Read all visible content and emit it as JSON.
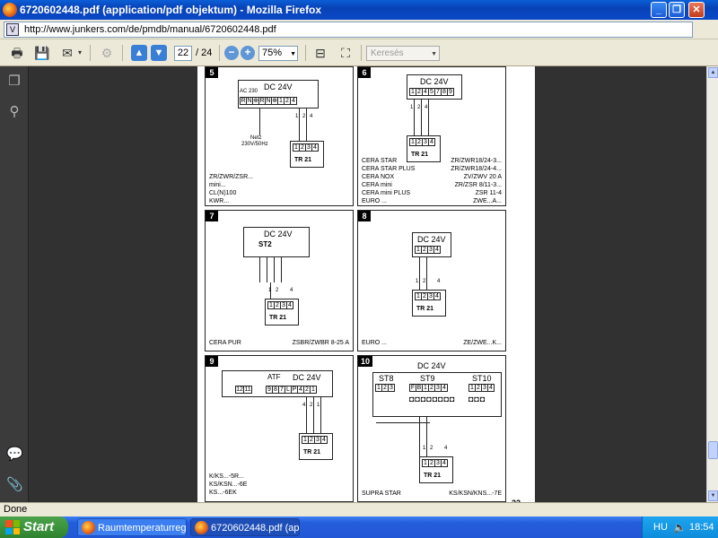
{
  "window": {
    "title": "6720602448.pdf (application/pdf objektum) - Mozilla Firefox",
    "minimize_label": "_",
    "maximize_label": "❐",
    "close_label": "✕"
  },
  "address": {
    "url": "http://www.junkers.com/de/pmdb/manual/6720602448.pdf",
    "site_icon": "V"
  },
  "pdf_toolbar": {
    "current_page": "22",
    "total_pages": "/ 24",
    "zoom": "75%",
    "search_placeholder": "Keresés"
  },
  "page": {
    "footer_page_number": "22",
    "panels": [
      {
        "number": "5",
        "header": "DC 24V",
        "ac_label": "AC 230",
        "top_cells": [
          "R",
          "N",
          "⊕",
          "R",
          "N",
          "⊕",
          "1",
          "2",
          "4"
        ],
        "netz_label": "Netz",
        "netz_voltage": "230V/50Hz",
        "wire_numbers": [
          "1",
          "2",
          "4"
        ],
        "tr_cells": [
          "1",
          "2",
          "3",
          "4"
        ],
        "tr_label": "TR 21",
        "captions": [
          "ZR/ZWR/ZSR...",
          "mini...",
          "CL(N)100",
          "KWR..."
        ]
      },
      {
        "number": "6",
        "header": "DC 24V",
        "top_cells": [
          "1",
          "2",
          "4",
          "5",
          "7",
          "8",
          "9"
        ],
        "wire_numbers": [
          "1",
          "2",
          "4"
        ],
        "tr_cells": [
          "1",
          "2",
          "3",
          "4"
        ],
        "tr_label": "TR 21",
        "captions_left": [
          "CERA STAR",
          "CERA STAR PLUS",
          "CERA NOX",
          "CERA mini",
          "CERA mini PLUS",
          "EURO ..."
        ],
        "captions_right": [
          "ZR/ZWR18/24-3...",
          "ZR/ZWR18/24-4...",
          "ZV/ZWV 20 A",
          "ZR/ZSR 8/11-3...",
          "ZSR 11-4",
          "ZWE...A..."
        ]
      },
      {
        "number": "7",
        "header": "DC 24V",
        "st_label": "ST2",
        "wire_numbers": [
          "1",
          "2",
          "4"
        ],
        "tr_cells": [
          "1",
          "2",
          "3",
          "4"
        ],
        "tr_label": "TR 21",
        "caption_left": "CERA PUR",
        "caption_right": "ZSBR/ZWBR 8-25 A"
      },
      {
        "number": "8",
        "header": "DC 24V",
        "top_cells": [
          "1",
          "2",
          "3",
          "4"
        ],
        "wire_numbers": [
          "1",
          "2",
          "4"
        ],
        "tr_cells": [
          "1",
          "2",
          "3",
          "4"
        ],
        "tr_label": "TR 21",
        "caption_left": "EURO ...",
        "caption_right": "ZE/ZWE...K..."
      },
      {
        "number": "9",
        "header": "DC 24V",
        "atf_label": "ATF",
        "left_cells": [
          "12",
          "11"
        ],
        "top_cells": [
          "9",
          "8",
          "7",
          "L",
          "P",
          "4",
          "2",
          "1"
        ],
        "wire_numbers": [
          "4",
          "2",
          "1"
        ],
        "tr_cells": [
          "1",
          "2",
          "3",
          "4"
        ],
        "tr_label": "TR 21",
        "captions": [
          "K/KS...-5R...",
          "KS/KSN...-6E",
          "KS...-6EK"
        ]
      },
      {
        "number": "10",
        "header": "DC 24V",
        "st8_label": "ST8",
        "st9_label": "ST9",
        "st10_label": "ST10",
        "st8_cells": [
          "1",
          "2",
          "3"
        ],
        "st9_cells": [
          "F",
          "B",
          "1",
          "2",
          "3",
          "4"
        ],
        "st10_cells": [
          "1",
          "2",
          "3",
          "4"
        ],
        "wire_numbers": [
          "1",
          "2",
          "4"
        ],
        "tr_cells": [
          "1",
          "2",
          "3",
          "4"
        ],
        "tr_label": "TR 21",
        "caption_left": "SUPRA STAR",
        "caption_right": "KS/KSN/KNS...-7E"
      }
    ]
  },
  "status": {
    "text": "Done"
  },
  "taskbar": {
    "start_label": "Start",
    "items": [
      {
        "label": "Raumtemperaturregl..."
      },
      {
        "label": "6720602448.pdf (ap..."
      }
    ],
    "tray": {
      "language": "HU",
      "time": "18:54"
    }
  },
  "colors": {
    "titlebar": "#0842b6",
    "chrome": "#ece9d8",
    "content_bg": "#313131",
    "taskbar": "#245dda",
    "start": "#3c943c"
  }
}
